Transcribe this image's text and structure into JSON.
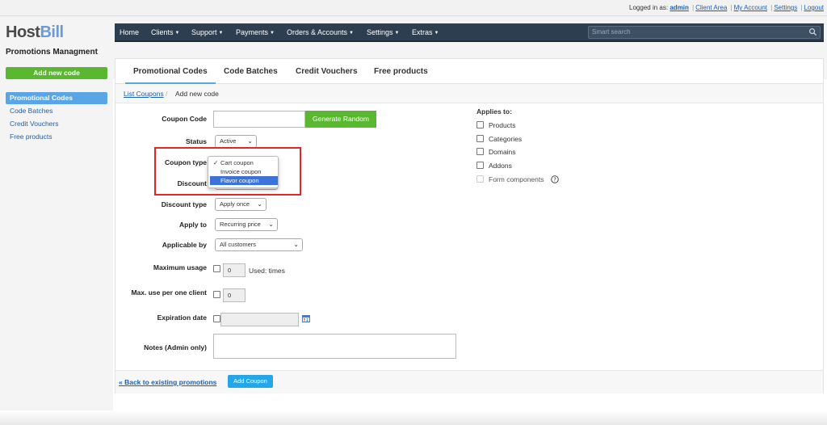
{
  "account": {
    "logged_in_as": "Logged in as:",
    "user": "admin",
    "links": [
      "Client Area",
      "My Account",
      "Settings",
      "Logout"
    ]
  },
  "brand": {
    "part1": "Host",
    "part2": "Bill",
    "subtitle": "Promotions Managment"
  },
  "nav": {
    "items": [
      {
        "label": "Home",
        "caret": false
      },
      {
        "label": "Clients",
        "caret": true
      },
      {
        "label": "Support",
        "caret": true
      },
      {
        "label": "Payments",
        "caret": true
      },
      {
        "label": "Orders & Accounts",
        "caret": true
      },
      {
        "label": "Settings",
        "caret": true
      },
      {
        "label": "Extras",
        "caret": true
      }
    ],
    "search_placeholder": "Smart search",
    "search_icon": "magnifier-icon"
  },
  "sidebar": {
    "add_button": "Add new code",
    "items": [
      "Promotional Codes",
      "Code Batches",
      "Credit Vouchers",
      "Free products"
    ],
    "active_index": 0
  },
  "tabs": {
    "items": [
      "Promotional Codes",
      "Code Batches",
      "Credit Vouchers",
      "Free products"
    ],
    "active_index": 0
  },
  "breadcrumb": {
    "link": "List Coupons",
    "separator": "/",
    "current": "Add new code"
  },
  "form": {
    "coupon_code": {
      "label": "Coupon Code",
      "value": "",
      "generate_label": "Generate Random"
    },
    "status": {
      "label": "Status",
      "value": "Active"
    },
    "coupon_type": {
      "label": "Coupon type",
      "options": [
        "Cart coupon",
        "Invoice coupon",
        "Flavor coupon"
      ],
      "checked_index": 0,
      "highlighted_index": 2
    },
    "discount": {
      "label": "Discount"
    },
    "discount_type": {
      "label": "Discount type",
      "value": "Apply once"
    },
    "apply_to": {
      "label": "Apply to",
      "value": "Recurring price"
    },
    "applicable_by": {
      "label": "Applicable by",
      "value": "All customers"
    },
    "maximum_usage": {
      "label": "Maximum usage",
      "value": "0",
      "used_text": "Used: times"
    },
    "max_per_client": {
      "label": "Max. use per one client",
      "value": "0"
    },
    "expiration_date": {
      "label": "Expiration date",
      "value": ""
    },
    "notes": {
      "label": "Notes (Admin only)",
      "value": ""
    }
  },
  "applies_to": {
    "title": "Applies to:",
    "items": [
      "Products",
      "Categories",
      "Domains",
      "Addons",
      "Form components"
    ]
  },
  "footer": {
    "back_link": "« Back to existing promotions",
    "add_button": "Add Coupon"
  },
  "colors": {
    "nav_bg": "#2c3e50",
    "green": "#59b82f",
    "blue_active": "#5aa5e6",
    "highlight_red": "#e4262b",
    "add_coupon_blue": "#23a7e8"
  }
}
